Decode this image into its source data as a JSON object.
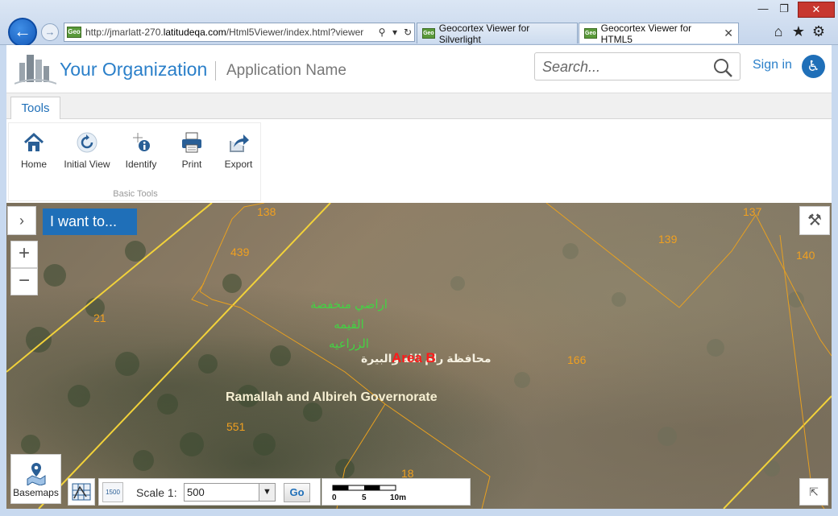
{
  "browser": {
    "url_prefix": "http://jmarlatt-270.",
    "url_domain": "latitudeqa.com",
    "url_rest": "/Html5Viewer/index.html?viewer",
    "tabs": [
      {
        "label": "Geocortex Viewer for Silverlight"
      },
      {
        "label": "Geocortex Viewer for HTML5"
      }
    ],
    "favicon_text": "Geo"
  },
  "header": {
    "org_name": "Your Organization",
    "app_name": "Application Name",
    "search_placeholder": "Search...",
    "signin_label": "Sign in"
  },
  "ribbon": {
    "tab_label": "Tools",
    "group_label": "Basic Tools",
    "tools": [
      {
        "label": "Home",
        "icon": "home-icon"
      },
      {
        "label": "Initial View",
        "icon": "refresh-icon"
      },
      {
        "label": "Identify",
        "icon": "identify-icon"
      },
      {
        "label": "Print",
        "icon": "printer-icon"
      },
      {
        "label": "Export",
        "icon": "export-icon"
      }
    ]
  },
  "map": {
    "iwant_label": "I want to...",
    "parcels": [
      "138",
      "439",
      "137",
      "139",
      "140",
      "21",
      "166",
      "551",
      "18"
    ],
    "arabic_label_1": "اراضي منخفضة",
    "arabic_label_2": "القيمه",
    "arabic_label_3": "الزراعيه",
    "arabic_governorate": "محافظة رام الله والبيرة",
    "area_label": "Area B",
    "governorate_label": "Ramallah and Albireh Governorate",
    "basemaps_label": "Basemaps",
    "scale_label": "Scale 1:",
    "scale_value": "500",
    "go_label": "Go",
    "scalebar_ticks": [
      "0",
      "5",
      "10m"
    ],
    "scale_icon_text": "1500"
  }
}
